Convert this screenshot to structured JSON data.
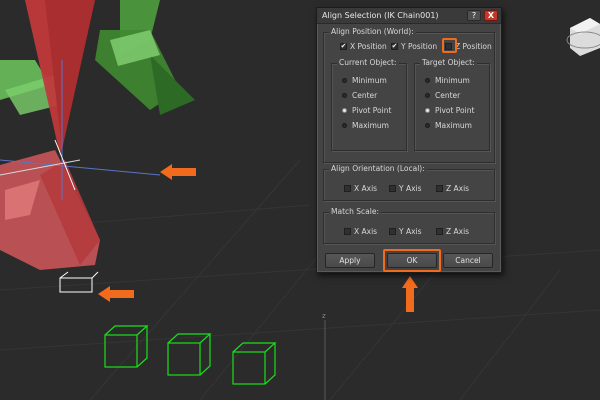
{
  "dialog": {
    "title": "Align Selection (IK Chain001)",
    "help_label": "?",
    "close_label": "X",
    "align_position": {
      "legend": "Align Position (World):",
      "x": {
        "label": "X Position",
        "checked": true
      },
      "y": {
        "label": "Y Position",
        "checked": true
      },
      "z": {
        "label": "Z Position",
        "checked": false
      }
    },
    "current_object": {
      "legend": "Current Object:",
      "options": [
        "Minimum",
        "Center",
        "Pivot Point",
        "Maximum"
      ],
      "selected": "Pivot Point"
    },
    "target_object": {
      "legend": "Target Object:",
      "options": [
        "Minimum",
        "Center",
        "Pivot Point",
        "Maximum"
      ],
      "selected": "Pivot Point"
    },
    "align_orientation": {
      "legend": "Align Orientation (Local):",
      "x": {
        "label": "X Axis",
        "checked": false
      },
      "y": {
        "label": "Y Axis",
        "checked": false
      },
      "z": {
        "label": "Z Axis",
        "checked": false
      }
    },
    "match_scale": {
      "legend": "Match Scale:",
      "x": {
        "label": "X Axis",
        "checked": false
      },
      "y": {
        "label": "Y Axis",
        "checked": false
      },
      "z": {
        "label": "Z Axis",
        "checked": false
      }
    },
    "buttons": {
      "apply": "Apply",
      "ok": "OK",
      "cancel": "Cancel"
    }
  },
  "viewport": {
    "axis_label": "z"
  },
  "colors": {
    "highlight": "#f26b1d",
    "background": "#2b2b2b",
    "dialog": "#444444",
    "red_object": "#c0393b",
    "green_object": "#3f9a34",
    "box_wire": "#19e019"
  }
}
